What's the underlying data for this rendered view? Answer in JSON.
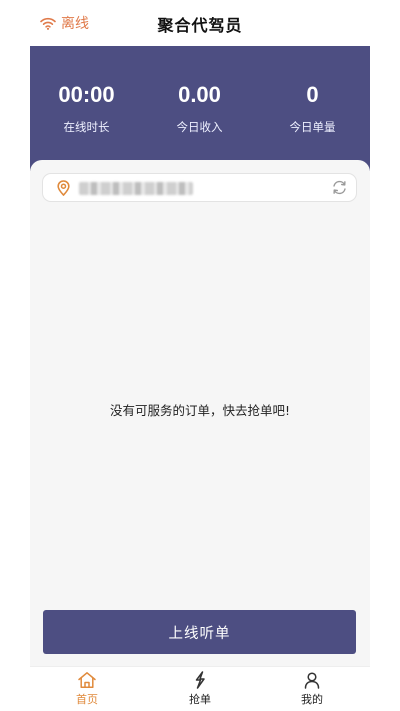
{
  "header": {
    "status_text": "离线",
    "status_icon": "wifi-icon",
    "title": "聚合代驾员"
  },
  "stats": [
    {
      "value": "00:00",
      "label": "在线时长"
    },
    {
      "value": "0.00",
      "label": "今日收入"
    },
    {
      "value": "0",
      "label": "今日单量"
    }
  ],
  "location": {
    "pin_icon": "location-pin-icon",
    "refresh_icon": "refresh-icon"
  },
  "empty_message": "没有可服务的订单，快去抢单吧!",
  "action": {
    "online_label": "上线听单"
  },
  "tabs": [
    {
      "label": "首页",
      "icon": "home-icon",
      "active": true
    },
    {
      "label": "抢单",
      "icon": "lightning-icon",
      "active": false
    },
    {
      "label": "我的",
      "icon": "user-icon",
      "active": false
    }
  ],
  "colors": {
    "brand": "#4d4e82",
    "status_offline": "#e07a4a",
    "tab_active": "#e08a3c",
    "background": "#f6f6f6"
  }
}
